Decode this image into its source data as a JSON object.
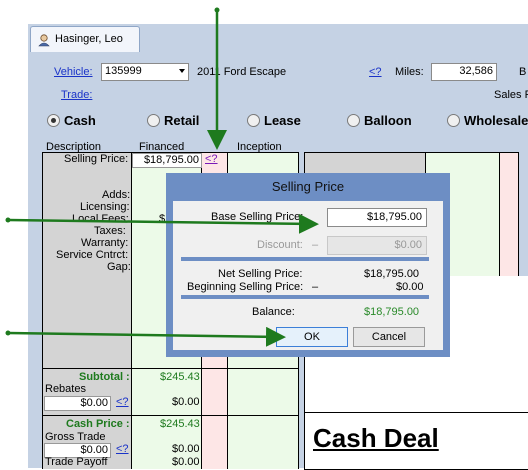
{
  "tab": {
    "label": "Hasinger, Leo",
    "icon": "person-icon"
  },
  "header": {
    "vehicle_link": "Vehicle:",
    "stock_value": "135999",
    "vehicle_desc": "2011 Ford Escape",
    "help_link": "<?",
    "miles_label": "Miles:",
    "miles_value": "32,586",
    "b_label": "B",
    "trade_link": "Trade:",
    "sales_label": "Sales F"
  },
  "deal_types": [
    {
      "label": "Cash",
      "selected": true
    },
    {
      "label": "Retail",
      "selected": false
    },
    {
      "label": "Lease",
      "selected": false
    },
    {
      "label": "Balloon",
      "selected": false
    },
    {
      "label": "Wholesale",
      "selected": false
    }
  ],
  "columns": {
    "description": "Description",
    "financed": "Financed",
    "inception": "Inception"
  },
  "rows": {
    "selling_price": "Selling Price:",
    "selling_price_value": "$18,795.00",
    "selling_price_help": "<?",
    "adds": "Adds:",
    "licensing": "Licensing:",
    "local_fees": "Local Fees:",
    "local_fees_value_partial": "$",
    "taxes": "Taxes:",
    "warranty": "Warranty:",
    "service_contract": "Service Cntrct:",
    "gap": "Gap:",
    "subtotal": "Subtotal :",
    "subtotal_value": "$245.43",
    "rebates": "Rebates",
    "rebates_input": "$0.00",
    "rebates_help": "<?",
    "rebates_value": "$0.00",
    "cash_price": "Cash Price :",
    "cash_price_value": "$245.43",
    "gross_trade": "Gross Trade",
    "gross_trade_input": "$0.00",
    "gross_trade_help": "<?",
    "gross_trade_value": "$0.00",
    "trade_payoff": "Trade Payoff",
    "trade_payoff_value": "$0.00"
  },
  "cash_deal_title": "Cash Deal",
  "dialog": {
    "title": "Selling Price",
    "base_label": "Base Selling Price:",
    "base_value": "$18,795.00",
    "discount_label": "Discount:",
    "discount_dash": "–",
    "discount_value": "$0.00",
    "net_label": "Net Selling Price:",
    "net_value": "$18,795.00",
    "beginning_label": "Beginning Selling Price:",
    "beginning_dash": "–",
    "beginning_value": "$0.00",
    "balance_label": "Balance:",
    "balance_value": "$18,795.00",
    "ok_label": "OK",
    "cancel_label": "Cancel"
  },
  "colors": {
    "panel": "#c5d2e4",
    "dialog_frame": "#6d8ec4",
    "callout_arrow": "#1e7a1e",
    "balance_green": "#2a8a2a",
    "link_blue": "#1a33c8"
  }
}
